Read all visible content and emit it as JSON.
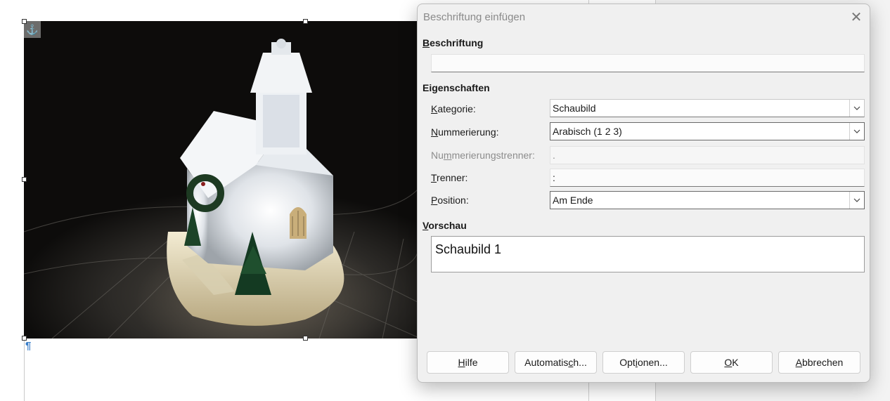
{
  "dialog": {
    "title": "Beschriftung einfügen",
    "close_icon": "close-icon",
    "caption_section": {
      "label_first": "B",
      "label_rest": "eschriftung",
      "value": ""
    },
    "properties_section": {
      "label": "Eigenschaften"
    },
    "fields": {
      "kategorie": {
        "label_first": "K",
        "label_rest": "ategorie:",
        "value": "Schaubild"
      },
      "nummerierung": {
        "label_first": "N",
        "label_rest": "ummerierung:",
        "value": "Arabisch (1 2 3)"
      },
      "nummerierungstrenner": {
        "label_pre": "Nu",
        "label_mid": "m",
        "label_post": "merierungstrenner:",
        "value": "."
      },
      "trenner": {
        "label_first": "T",
        "label_rest": "renner:",
        "value": ":"
      },
      "position": {
        "label_first": "P",
        "label_rest": "osition:",
        "value": "Am Ende"
      }
    },
    "preview_section": {
      "label_first": "V",
      "label_rest": "orschau",
      "value": "Schaubild 1"
    },
    "buttons": {
      "hilfe": {
        "pre": "",
        "u": "H",
        "post": "ilfe"
      },
      "automatisch": {
        "pre": "Automatis",
        "u": "c",
        "post": "h..."
      },
      "optionen": {
        "pre": "Opt",
        "u": "i",
        "post": "onen..."
      },
      "ok": {
        "pre": "",
        "u": "O",
        "post": "K"
      },
      "abbrechen": {
        "pre": "",
        "u": "A",
        "post": "bbrechen"
      }
    }
  },
  "document": {
    "pilcrow": "¶",
    "anchor_icon": "anchor-icon",
    "image": "church-snow-globe-photo"
  }
}
